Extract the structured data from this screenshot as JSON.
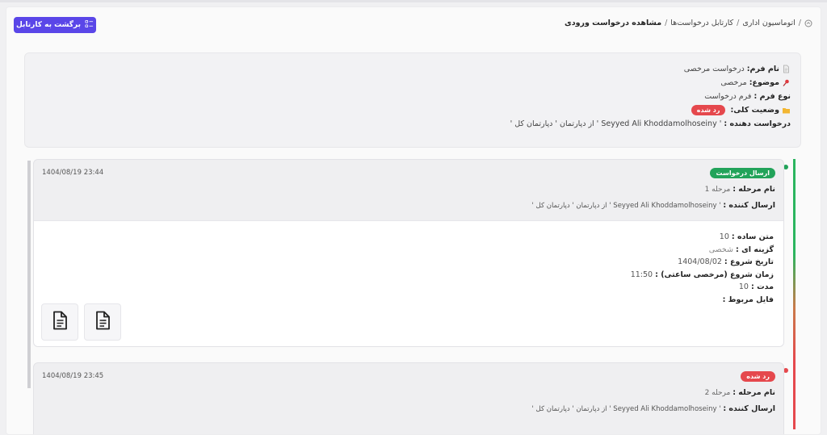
{
  "breadcrumb": {
    "items": [
      "اتوماسیون اداری",
      "کارتابل درخواست‌ها",
      "مشاهده درخواست ورودی"
    ],
    "separator": "/"
  },
  "back_button": {
    "label": "برگشت به کارتابل",
    "icon": "list-icon"
  },
  "info": {
    "form_name_label": "نام فرم:",
    "form_name_value": "درخواست مرخصی",
    "subject_label": "موضوع:",
    "subject_value": "مرخصی",
    "form_type_label": "نوع فرم :",
    "form_type_value": "فرم درخواست",
    "status_label": "وضعیت کلی:",
    "status_value": "رد شده",
    "requester_label": "درخواست دهنده :",
    "requester_value": "' Seyyed Ali Khoddamolhoseiny ' از دپارتمان ' دپارتمان کل '",
    "icons": {
      "form": "document-icon",
      "subject": "pin-icon",
      "status": "folder-icon"
    }
  },
  "steps": [
    {
      "badge": "ارسال درخواست",
      "badge_color": "#22a35a",
      "time": "1404/08/19 23:44",
      "stage_label": "نام مرحله :",
      "stage_value": "مرحله 1",
      "sender_label": "ارسال کننده :",
      "sender_value": "' Seyyed Ali Khoddamolhoseiny ' از دپارتمان ' دپارتمان کل '",
      "fields": [
        {
          "label": "متن ساده :",
          "value": "10"
        },
        {
          "label": "گزینه ای :",
          "value": "شخصی"
        },
        {
          "label": "تاریخ شروع :",
          "value": "1404/08/02"
        },
        {
          "label": "زمان شروع (مرخصی ساعتی) :",
          "value": "11:50"
        },
        {
          "label": "مدت :",
          "value": "10"
        },
        {
          "label": "فایل مربوط :",
          "value": ""
        }
      ],
      "files": [
        "file-icon",
        "file-icon"
      ]
    },
    {
      "badge": "رد شده",
      "badge_color": "#e5484d",
      "time": "1404/08/19 23:45",
      "stage_label": "نام مرحله :",
      "stage_value": "مرحله 2",
      "sender_label": "ارسال کننده :",
      "sender_value": "' Seyyed Ali Khoddamolhoseiny ' از دپارتمان ' دپارتمان کل '"
    }
  ],
  "colors": {
    "accent": "#5a46e8",
    "success": "#22a35a",
    "danger": "#e5484d"
  }
}
